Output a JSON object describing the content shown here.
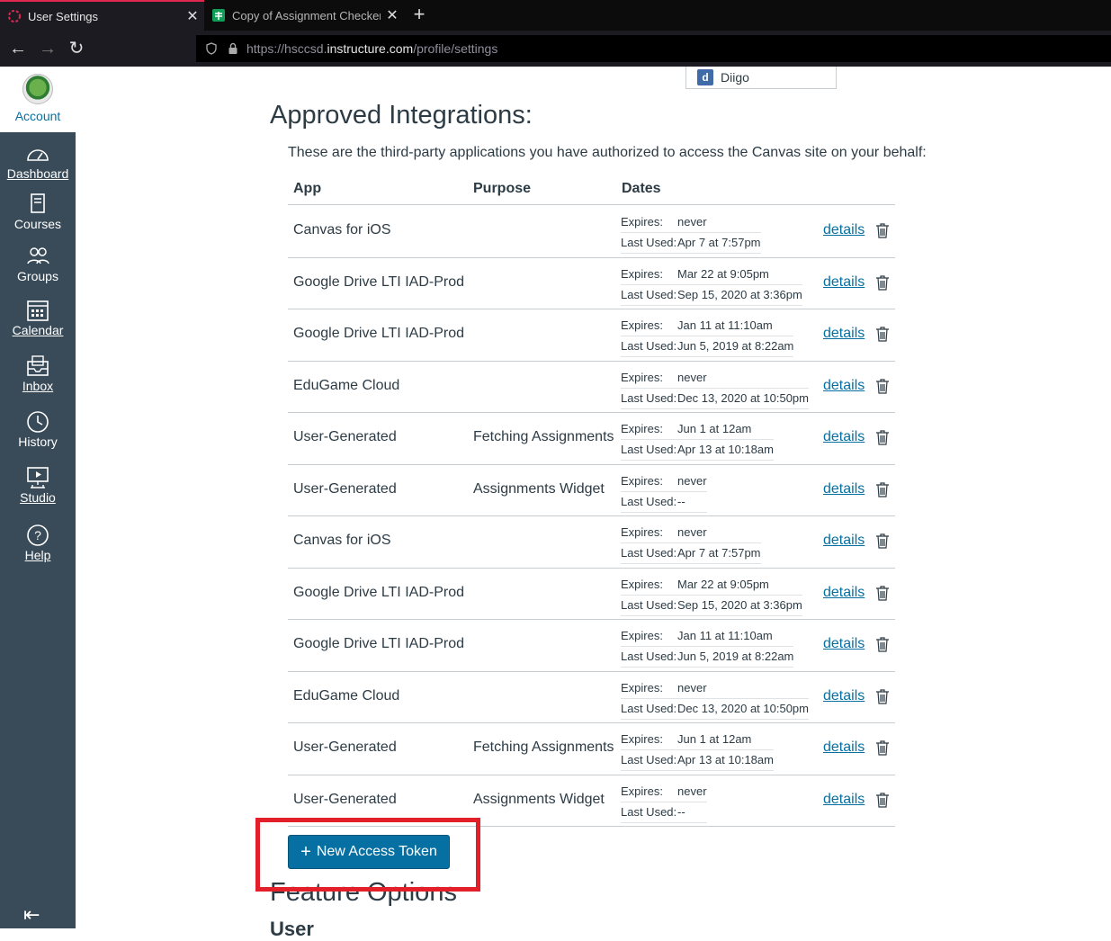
{
  "browser": {
    "tabs": [
      {
        "title": "User Settings",
        "active": true,
        "favicon": "canvas-icon"
      },
      {
        "title": "Copy of Assignment Checker (",
        "active": false,
        "favicon": "sheets-icon"
      }
    ],
    "url_prefix": "https://hsccsd.",
    "url_domain": "instructure.com",
    "url_path": "/profile/settings"
  },
  "sidebar": {
    "account": "Account",
    "items": [
      {
        "label": "Dashboard",
        "icon": "dashboard-icon"
      },
      {
        "label": "Courses",
        "icon": "courses-icon"
      },
      {
        "label": "Groups",
        "icon": "groups-icon"
      },
      {
        "label": "Calendar",
        "icon": "calendar-icon"
      },
      {
        "label": "Inbox",
        "icon": "inbox-icon"
      },
      {
        "label": "History",
        "icon": "history-icon"
      },
      {
        "label": "Studio",
        "icon": "studio-icon"
      },
      {
        "label": "Help",
        "icon": "help-icon"
      }
    ]
  },
  "diigo": "Diigo",
  "integrations": {
    "title": "Approved Integrations:",
    "description": "These are the third-party applications you have authorized to access the Canvas site on your behalf:",
    "headers": {
      "app": "App",
      "purpose": "Purpose",
      "dates": "Dates"
    },
    "expires_label": "Expires:",
    "last_used_label": "Last Used:",
    "details_label": "details",
    "rows": [
      {
        "app": "Canvas for iOS",
        "purpose": "",
        "expires": "never",
        "last_used": "Apr 7 at 7:57pm"
      },
      {
        "app": "Google Drive LTI IAD-Prod",
        "purpose": "",
        "expires": "Mar 22 at 9:05pm",
        "last_used": "Sep 15, 2020 at 3:36pm"
      },
      {
        "app": "Google Drive LTI IAD-Prod",
        "purpose": "",
        "expires": "Jan 11 at 11:10am",
        "last_used": "Jun 5, 2019 at 8:22am"
      },
      {
        "app": "EduGame Cloud",
        "purpose": "",
        "expires": "never",
        "last_used": "Dec 13, 2020 at 10:50pm"
      },
      {
        "app": "User-Generated",
        "purpose": "Fetching Assignments",
        "expires": "Jun 1 at 12am",
        "last_used": "Apr 13 at 10:18am"
      },
      {
        "app": "User-Generated",
        "purpose": "Assignments Widget",
        "expires": "never",
        "last_used": "--"
      },
      {
        "app": "Canvas for iOS",
        "purpose": "",
        "expires": "never",
        "last_used": "Apr 7 at 7:57pm"
      },
      {
        "app": "Google Drive LTI IAD-Prod",
        "purpose": "",
        "expires": "Mar 22 at 9:05pm",
        "last_used": "Sep 15, 2020 at 3:36pm"
      },
      {
        "app": "Google Drive LTI IAD-Prod",
        "purpose": "",
        "expires": "Jan 11 at 11:10am",
        "last_used": "Jun 5, 2019 at 8:22am"
      },
      {
        "app": "EduGame Cloud",
        "purpose": "",
        "expires": "never",
        "last_used": "Dec 13, 2020 at 10:50pm"
      },
      {
        "app": "User-Generated",
        "purpose": "Fetching Assignments",
        "expires": "Jun 1 at 12am",
        "last_used": "Apr 13 at 10:18am"
      },
      {
        "app": "User-Generated",
        "purpose": "Assignments Widget",
        "expires": "never",
        "last_used": "--"
      }
    ]
  },
  "new_token_button": "New Access Token",
  "feature_options": "Feature Options",
  "feature_sub": "User",
  "colors": {
    "accent": "#0770a3",
    "sidebar": "#394b58",
    "highlight": "#e3202a"
  }
}
